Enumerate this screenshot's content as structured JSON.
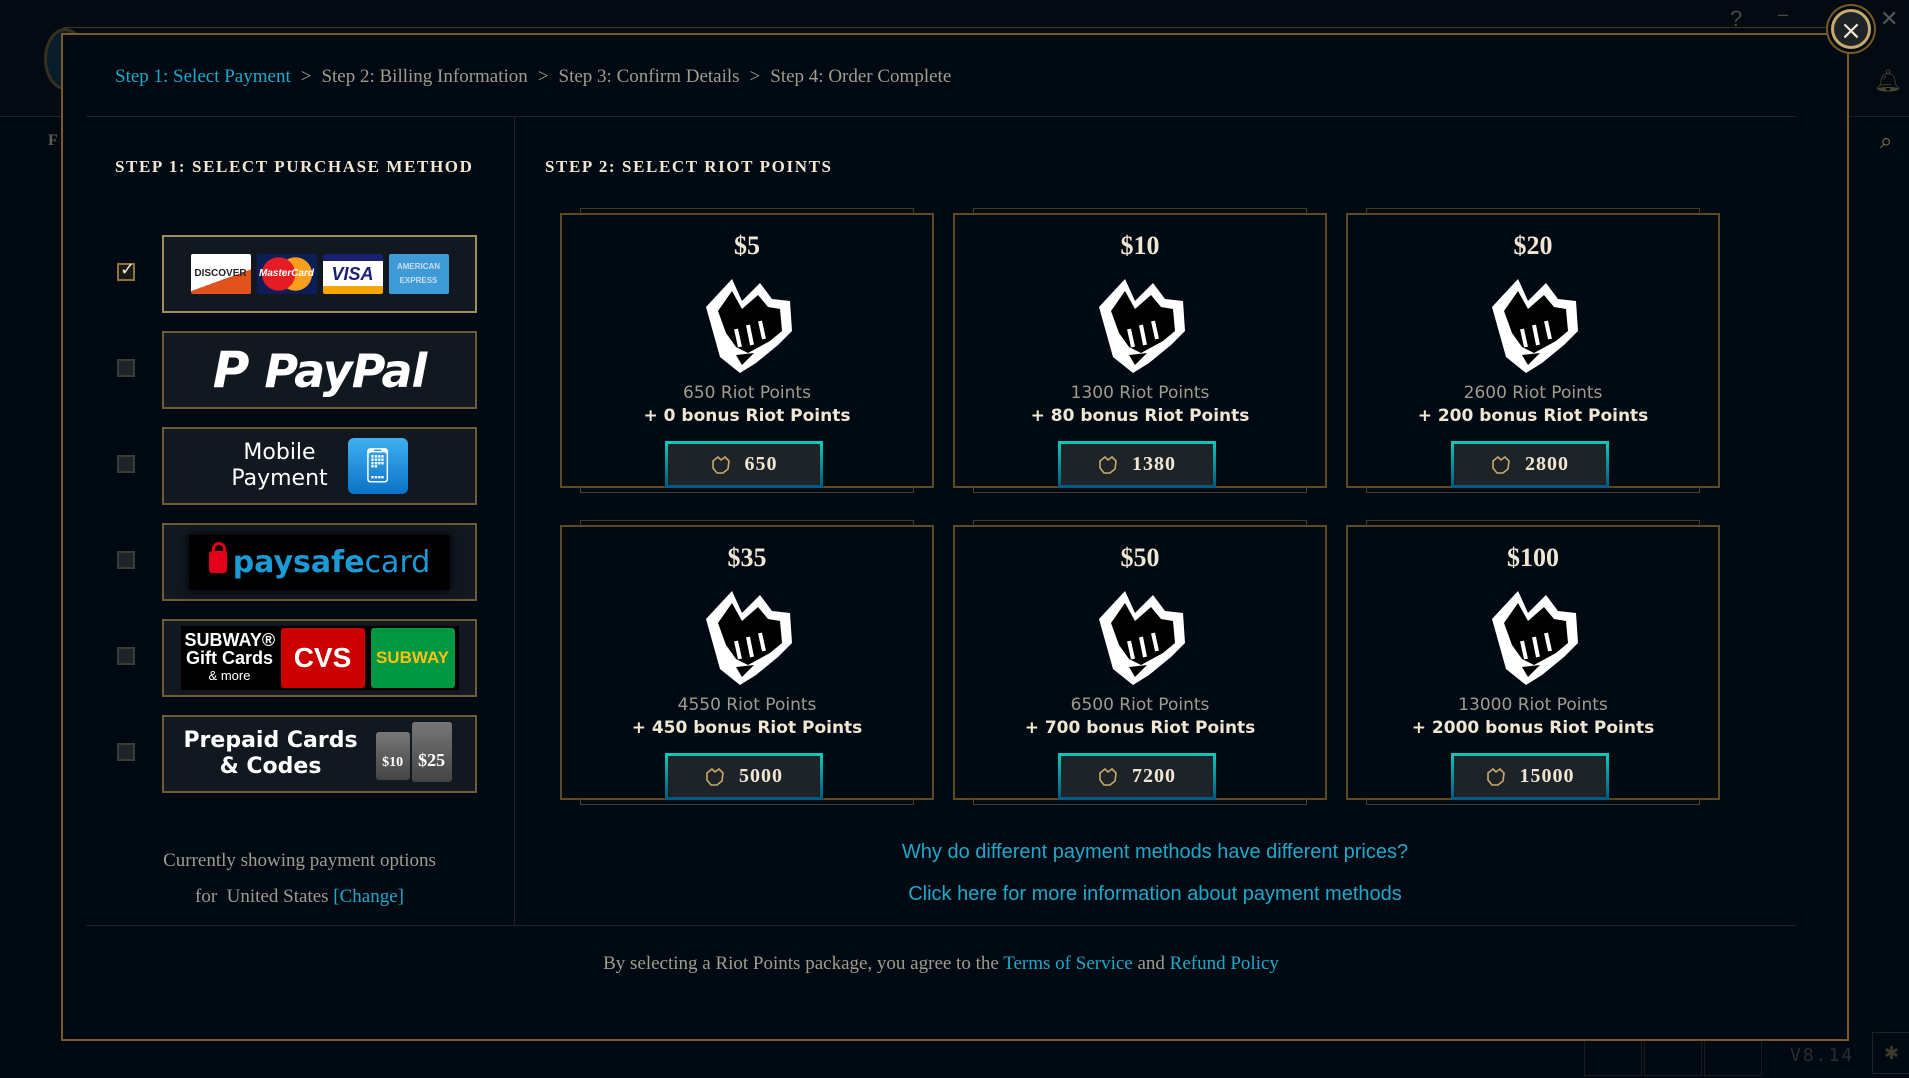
{
  "background": {
    "left_tab_initial": "F",
    "version": "V8.14",
    "icons": [
      "help-icon",
      "minimize-icon",
      "close-window-icon",
      "bell-icon",
      "search-icon",
      "bug-icon"
    ]
  },
  "modal": {
    "close_label": "×",
    "breadcrumb": [
      {
        "label": "Step 1: Select Payment",
        "active": true
      },
      {
        "label": "Step 2: Billing Information",
        "active": false
      },
      {
        "label": "Step 3: Confirm Details",
        "active": false
      },
      {
        "label": "Step 4: Order Complete",
        "active": false
      }
    ],
    "breadcrumb_separator": ">",
    "left_panel": {
      "title": "STEP 1: SELECT PURCHASE METHOD",
      "methods": [
        {
          "id": "credit-card",
          "selected": true,
          "logos": [
            "DISCOVER",
            "MasterCard",
            "VISA",
            "AMERICAN EXPRESS"
          ]
        },
        {
          "id": "paypal",
          "selected": false,
          "label": "PayPal"
        },
        {
          "id": "mobile-payment",
          "selected": false,
          "label_line1": "Mobile",
          "label_line2": "Payment"
        },
        {
          "id": "paysafecard",
          "selected": false,
          "label_a": "paysafe",
          "label_b": "card"
        },
        {
          "id": "gift-cards",
          "selected": false,
          "brand": "SUBWAY®",
          "line2": "Gift Cards",
          "line3": "& more",
          "logo_cvs": "CVS",
          "logo_subway": "SUBWAY"
        },
        {
          "id": "prepaid-cards",
          "selected": false,
          "label_line1": "Prepaid Cards",
          "label_line2": "& Codes",
          "card_small": "$10",
          "card_large": "$25"
        }
      ],
      "country_line1": "Currently showing payment options",
      "country_prefix": "for",
      "country": "United States",
      "change_label": "[Change]"
    },
    "right_panel": {
      "title": "STEP 2: SELECT RIOT POINTS",
      "packages": [
        {
          "price": "$5",
          "base": "650 Riot Points",
          "bonus": "+ 0 bonus Riot Points",
          "total": "650"
        },
        {
          "price": "$10",
          "base": "1300 Riot Points",
          "bonus": "+ 80 bonus Riot Points",
          "total": "1380"
        },
        {
          "price": "$20",
          "base": "2600 Riot Points",
          "bonus": "+ 200 bonus Riot Points",
          "total": "2800"
        },
        {
          "price": "$35",
          "base": "4550 Riot Points",
          "bonus": "+ 450 bonus Riot Points",
          "total": "5000"
        },
        {
          "price": "$50",
          "base": "6500 Riot Points",
          "bonus": "+ 700 bonus Riot Points",
          "total": "7200"
        },
        {
          "price": "$100",
          "base": "13000 Riot Points",
          "bonus": "+ 2000 bonus Riot Points",
          "total": "15000"
        }
      ],
      "link_prices": "Why do different payment methods have different prices?",
      "link_info": "Click here for more information about payment methods"
    },
    "footer": {
      "prefix": "By selecting a Riot Points package, you agree to the",
      "terms": "Terms of Service",
      "and": "and",
      "refund": "Refund Policy"
    }
  },
  "colors": {
    "accent_link": "#1fa8c9",
    "gold_border": "#785a28",
    "text_primary": "#f0e6d2",
    "text_muted": "#a09b8c",
    "background": "#010a13"
  }
}
